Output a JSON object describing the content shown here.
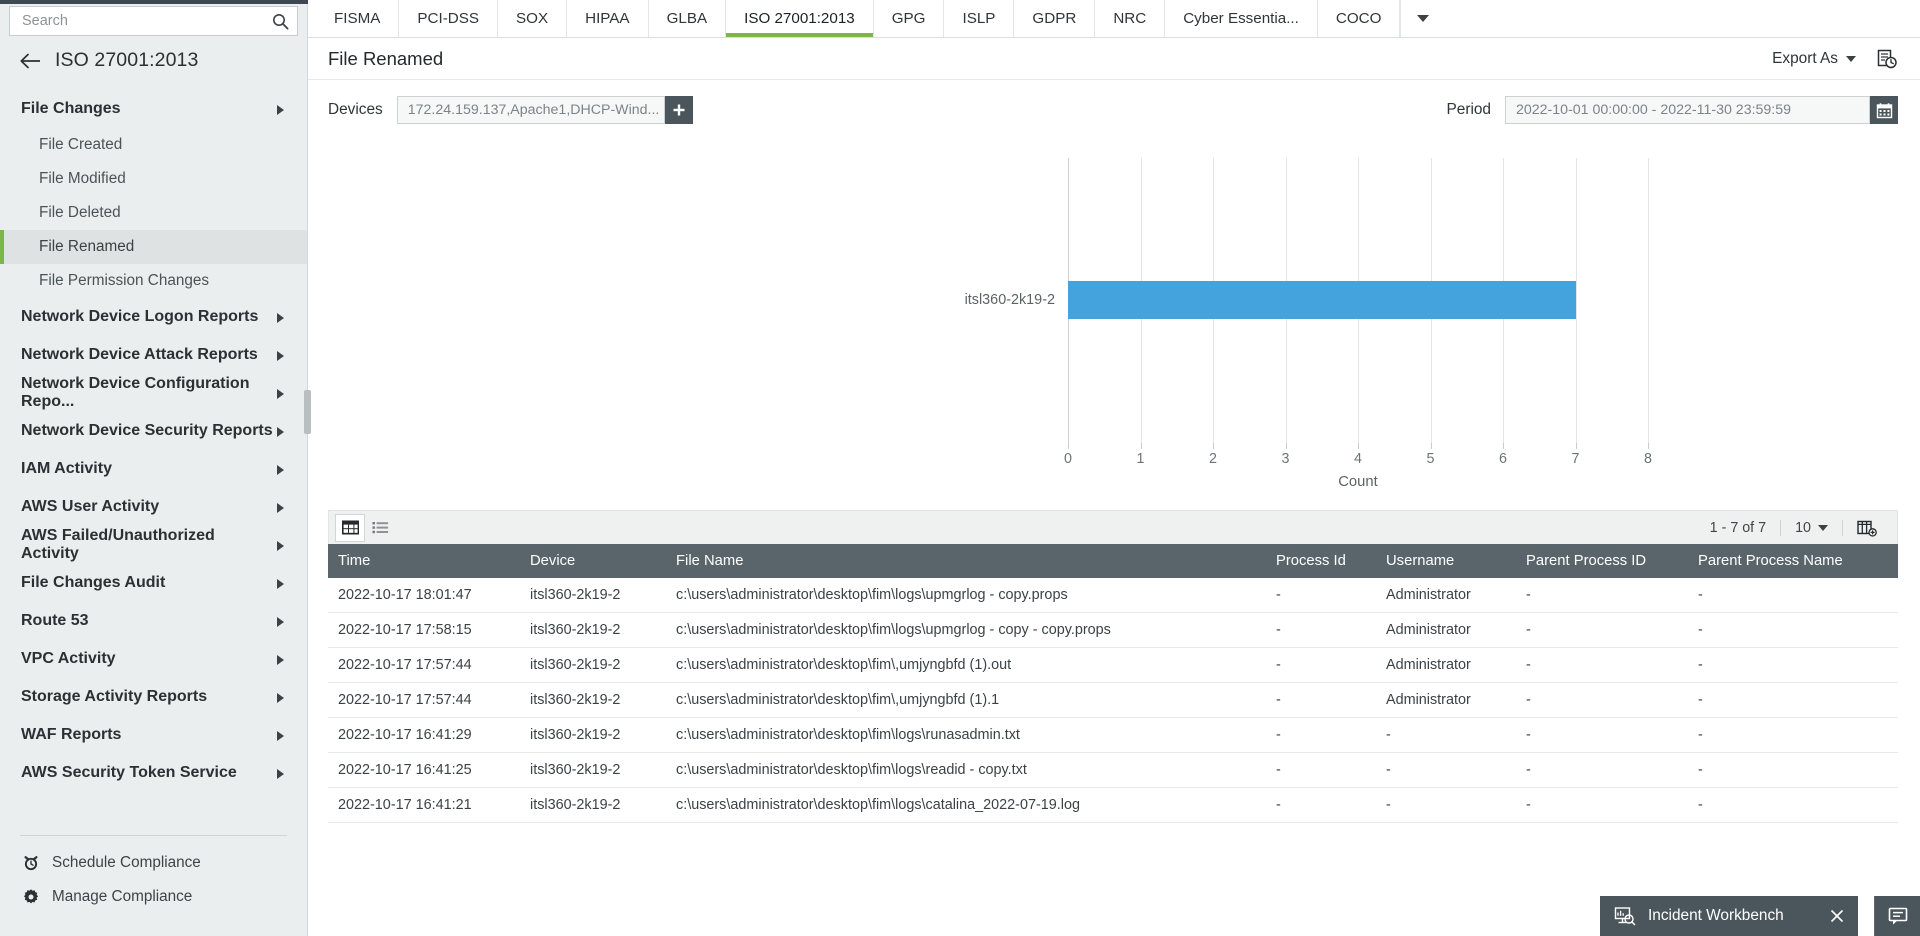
{
  "search": {
    "placeholder": "Search",
    "value": "",
    "icon": "search-icon"
  },
  "sidebar": {
    "back_icon": "back-arrow-icon",
    "title": "ISO 27001:2013",
    "groups": [
      {
        "label": "File Changes",
        "expanded": true,
        "children": [
          {
            "label": "File Created",
            "selected": false
          },
          {
            "label": "File Modified",
            "selected": false
          },
          {
            "label": "File Deleted",
            "selected": false
          },
          {
            "label": "File Renamed",
            "selected": true
          },
          {
            "label": "File Permission Changes",
            "selected": false
          }
        ]
      },
      {
        "label": "Network Device Logon Reports",
        "expanded": false,
        "children": []
      },
      {
        "label": "Network Device Attack Reports",
        "expanded": false,
        "children": []
      },
      {
        "label": "Network Device Configuration Repo...",
        "expanded": false,
        "children": []
      },
      {
        "label": "Network Device Security Reports",
        "expanded": false,
        "children": []
      },
      {
        "label": "IAM Activity",
        "expanded": false,
        "children": []
      },
      {
        "label": "AWS User Activity",
        "expanded": false,
        "children": []
      },
      {
        "label": "AWS Failed/Unauthorized Activity",
        "expanded": false,
        "children": []
      },
      {
        "label": "File Changes Audit",
        "expanded": false,
        "children": []
      },
      {
        "label": "Route 53",
        "expanded": false,
        "children": []
      },
      {
        "label": "VPC Activity",
        "expanded": false,
        "children": []
      },
      {
        "label": "Storage Activity Reports",
        "expanded": false,
        "children": []
      },
      {
        "label": "WAF Reports",
        "expanded": false,
        "children": []
      },
      {
        "label": "AWS Security Token Service",
        "expanded": false,
        "children": []
      }
    ],
    "footer": [
      {
        "label": "Schedule Compliance",
        "icon": "alarm-clock-icon"
      },
      {
        "label": "Manage Compliance",
        "icon": "gear-icon"
      }
    ]
  },
  "tabs": {
    "items": [
      {
        "label": "FISMA",
        "active": false
      },
      {
        "label": "PCI-DSS",
        "active": false
      },
      {
        "label": "SOX",
        "active": false
      },
      {
        "label": "HIPAA",
        "active": false
      },
      {
        "label": "GLBA",
        "active": false
      },
      {
        "label": "ISO 27001:2013",
        "active": true
      },
      {
        "label": "GPG",
        "active": false
      },
      {
        "label": "ISLP",
        "active": false
      },
      {
        "label": "GDPR",
        "active": false
      },
      {
        "label": "NRC",
        "active": false
      },
      {
        "label": "Cyber Essentia...",
        "active": false
      },
      {
        "label": "COCO",
        "active": false
      }
    ],
    "more_icon": "chevron-down-icon"
  },
  "header": {
    "title": "File Renamed",
    "export_label": "Export As",
    "export_caret_icon": "chevron-down-icon",
    "schedule_icon": "schedule-report-icon"
  },
  "filters": {
    "devices_label": "Devices",
    "devices_value": "172.24.159.137,Apache1,DHCP-Wind...",
    "add_device_icon": "plus-icon",
    "period_label": "Period",
    "period_value": "2022-10-01 00:00:00 - 2022-11-30 23:59:59",
    "calendar_icon": "calendar-icon"
  },
  "chart_data": {
    "type": "bar",
    "orientation": "horizontal",
    "title": "",
    "categories": [
      "itsl360-2k19-2"
    ],
    "values": [
      7
    ],
    "series": [
      {
        "name": "Count",
        "values": [
          7
        ]
      }
    ],
    "xlabel": "Count",
    "ylabel": "",
    "xlim": [
      0,
      8
    ],
    "xticks": [
      0,
      1,
      2,
      3,
      4,
      5,
      6,
      7,
      8
    ],
    "bar_color": "#44a3dd",
    "grid": true,
    "legend": false
  },
  "table_tools": {
    "grid_view_icon": "grid-view-icon",
    "list_view_icon": "list-view-icon",
    "active_view": "grid",
    "range_text": "1 - 7 of 7",
    "page_size": "10",
    "page_size_caret_icon": "chevron-down-icon",
    "add_column_icon": "add-column-icon"
  },
  "table": {
    "columns": [
      "Time",
      "Device",
      "File Name",
      "Process Id",
      "Username",
      "Parent Process ID",
      "Parent Process Name"
    ],
    "rows": [
      [
        "2022-10-17 18:01:47",
        "itsl360-2k19-2",
        "c:\\users\\administrator\\desktop\\fim\\logs\\upmgrlog - copy.props",
        "-",
        "Administrator",
        "-",
        "-"
      ],
      [
        "2022-10-17 17:58:15",
        "itsl360-2k19-2",
        "c:\\users\\administrator\\desktop\\fim\\logs\\upmgrlog - copy - copy.props",
        "-",
        "Administrator",
        "-",
        "-"
      ],
      [
        "2022-10-17 17:57:44",
        "itsl360-2k19-2",
        "c:\\users\\administrator\\desktop\\fim\\,umjyngbfd (1).out",
        "-",
        "Administrator",
        "-",
        "-"
      ],
      [
        "2022-10-17 17:57:44",
        "itsl360-2k19-2",
        "c:\\users\\administrator\\desktop\\fim\\,umjyngbfd (1).1",
        "-",
        "Administrator",
        "-",
        "-"
      ],
      [
        "2022-10-17 16:41:29",
        "itsl360-2k19-2",
        "c:\\users\\administrator\\desktop\\fim\\logs\\runasadmin.txt",
        "-",
        "-",
        "-",
        "-"
      ],
      [
        "2022-10-17 16:41:25",
        "itsl360-2k19-2",
        "c:\\users\\administrator\\desktop\\fim\\logs\\readid - copy.txt",
        "-",
        "-",
        "-",
        "-"
      ],
      [
        "2022-10-17 16:41:21",
        "itsl360-2k19-2",
        "c:\\users\\administrator\\desktop\\fim\\logs\\catalina_2022-07-19.log",
        "-",
        "-",
        "-",
        "-"
      ]
    ]
  },
  "workbench": {
    "label": "Incident Workbench",
    "icon": "workbench-monitor-icon",
    "close_icon": "close-icon",
    "chat_icon": "chat-icon"
  },
  "colors": {
    "accent_green": "#7ab648",
    "bar_blue": "#44a3dd",
    "header_slate": "#5a656b",
    "dark_slate": "#4b565c"
  }
}
